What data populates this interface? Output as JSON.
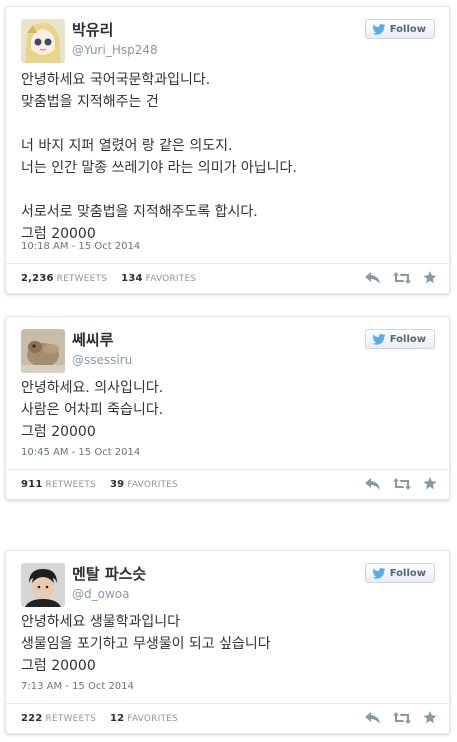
{
  "follow_label": "Follow",
  "retweets_label": "RETWEETS",
  "favorites_label": "FAVORITES",
  "colors": {
    "card_border": "#e1e8ed",
    "muted": "#8899a6",
    "icon": "#8899a6",
    "bird": "#55acee"
  },
  "tweets": [
    {
      "name": "박유리",
      "handle": "@Yuri_Hsp248",
      "lines": [
        "안녕하세요 국어국문학과입니다.",
        "맞춤법을 지적해주는 건",
        "",
        "너 바지 지퍼 열렸어 랑 같은 의도지.",
        "너는 인간 말종 쓰레기야 라는 의미가 아닙니다.",
        "",
        "서로서로 맞춤법을 지적해주도록 합시다.",
        "그럼 20000"
      ],
      "time": "10:18 AM - 15 Oct 2014",
      "retweets": "2,236",
      "favorites": "134"
    },
    {
      "name": "쎄씨루",
      "handle": "@ssessiru",
      "lines": [
        "안녕하세요. 의사입니다.",
        "사람은 어차피 죽습니다.",
        "그럼 20000"
      ],
      "time": "10:45 AM - 15 Oct 2014",
      "retweets": "911",
      "favorites": "39"
    },
    {
      "name": "멘탈 파스슷",
      "handle": "@d_owoa",
      "lines": [
        "안녕하세요 생물학과입니다",
        "생물임을 포기하고 무생물이 되고 싶습니다",
        "그럼 20000"
      ],
      "time": "7:13 AM - 15 Oct 2014",
      "retweets": "222",
      "favorites": "12"
    }
  ]
}
